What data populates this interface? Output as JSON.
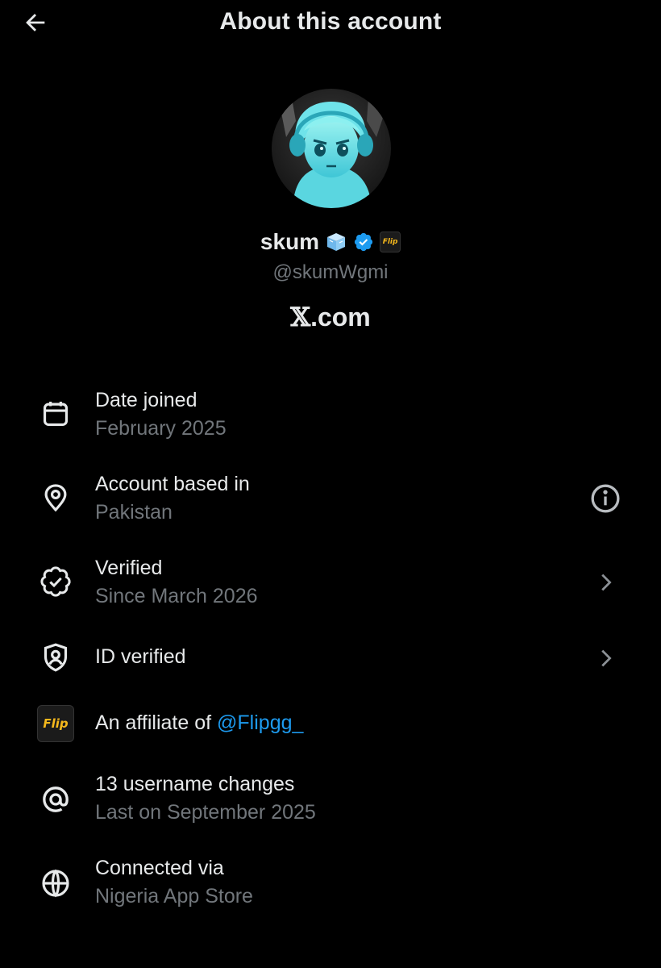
{
  "header": {
    "title": "About this account",
    "back_icon": "arrow-left-icon"
  },
  "profile": {
    "display_name": "skum",
    "handle": "@skumWgmi",
    "site": ".com",
    "site_mark": "𝕏",
    "verified_color": "#1d9bf0",
    "name_emoji_icon": "ice-cube-icon",
    "affiliate_badge_icon": "flip-gg-badge-icon"
  },
  "rows": [
    {
      "icon": "calendar-icon",
      "title": "Date joined",
      "subtitle": "February 2025",
      "right": ""
    },
    {
      "icon": "location-pin-icon",
      "title": "Account based in",
      "subtitle": "Pakistan",
      "right": "info-icon"
    },
    {
      "icon": "verified-badge-icon",
      "title": "Verified",
      "subtitle": "Since March 2026",
      "right": "chevron-right-icon"
    },
    {
      "icon": "shield-user-icon",
      "title": "ID verified",
      "subtitle": "",
      "right": "chevron-right-icon"
    },
    {
      "icon": "flip-gg-badge-icon",
      "title_prefix": "An affiliate of ",
      "title_link": "@Flipgg_",
      "right": ""
    },
    {
      "icon": "at-sign-icon",
      "title": "13 username changes",
      "subtitle": "Last on September 2025",
      "right": ""
    },
    {
      "icon": "globe-icon",
      "title": "Connected via",
      "subtitle": "Nigeria App Store",
      "right": ""
    }
  ],
  "badge_text": "Flip"
}
